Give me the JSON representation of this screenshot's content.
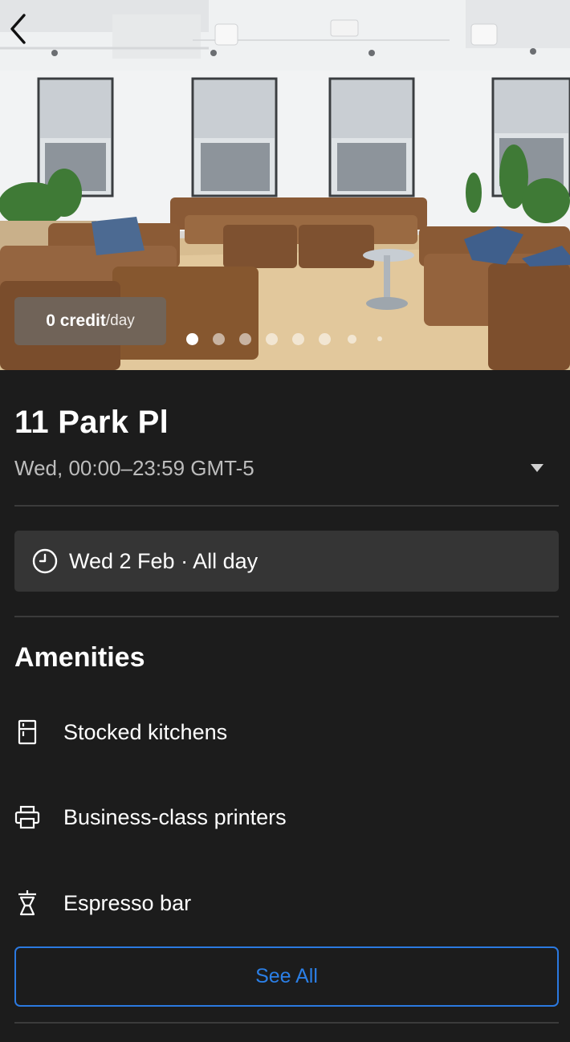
{
  "hero": {
    "photo_alt_icon": "coworking-lounge-photo",
    "back_icon": "chevron-left-icon",
    "credit": {
      "amount": "0 credit",
      "unit": "/day"
    },
    "carousel": {
      "total_dots": 8,
      "active_index": 0
    }
  },
  "space": {
    "title": "11 Park Pl",
    "hours": "Wed, 00:00–23:59 GMT-5",
    "hours_toggle_icon": "caret-down-icon"
  },
  "booking": {
    "date_icon": "clock-icon",
    "date_text": "Wed 2 Feb · All day"
  },
  "amenities": {
    "title": "Amenities",
    "items": [
      {
        "label": "Stocked kitchens",
        "icon": "fridge-icon"
      },
      {
        "label": "Business-class printers",
        "icon": "printer-icon"
      },
      {
        "label": "Espresso bar",
        "icon": "espresso-icon"
      }
    ],
    "see_all_label": "See All"
  },
  "colors": {
    "background": "#1c1c1c",
    "accent": "#2b79e0",
    "card": "#353535",
    "muted_text": "#bdbdbd"
  }
}
